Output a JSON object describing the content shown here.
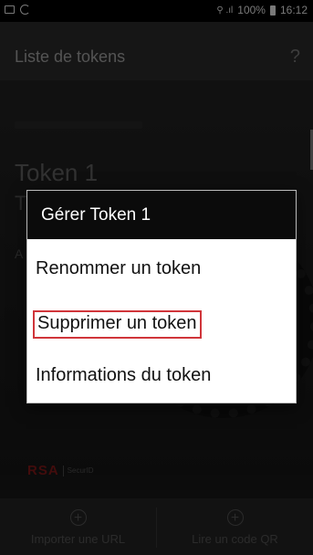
{
  "status_bar": {
    "signal_glyph": "⚲ .ıl",
    "battery_level": "100%",
    "time": "16:12"
  },
  "app_bar": {
    "title": "Liste de tokens",
    "help_label": "?"
  },
  "background": {
    "token_name": "Token 1",
    "token_code": "T",
    "token_sub": "A",
    "brand": {
      "rsa": "RSA",
      "securid": "SecurID",
      "rsa_color": "#7a1717"
    }
  },
  "bottom_bar": {
    "import_url_label": "Importer une URL",
    "scan_qr_label": "Lire un code QR"
  },
  "dialog": {
    "title": "Gérer Token 1",
    "items": [
      {
        "label": "Renommer un token"
      },
      {
        "label": "Supprimer un token",
        "highlighted": true
      },
      {
        "label": "Informations du token"
      }
    ],
    "highlight_color": "#d0353a"
  },
  "icons": [
    "image-icon",
    "sync-icon",
    "signal-icon",
    "battery-icon",
    "plus-icon",
    "help-icon"
  ]
}
